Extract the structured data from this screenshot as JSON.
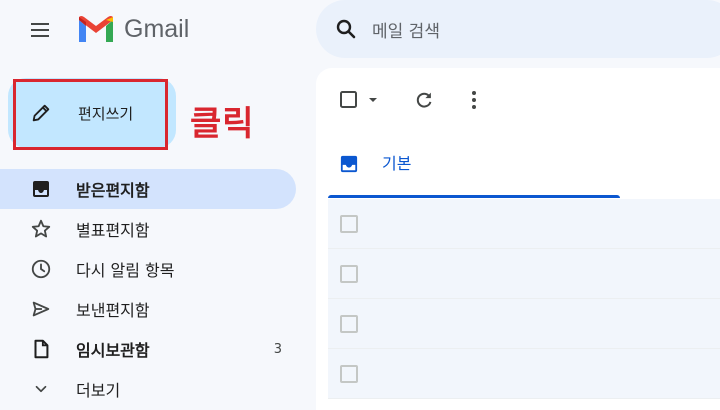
{
  "header": {
    "brand_text": "Gmail",
    "search_placeholder": "메일 검색"
  },
  "compose": {
    "label": "편지쓰기"
  },
  "annotation": {
    "text": "클릭",
    "color": "#d9262f"
  },
  "sidebar": {
    "items": [
      {
        "label": "받은편지함",
        "icon": "inbox-icon",
        "active": true,
        "bold": true
      },
      {
        "label": "별표편지함",
        "icon": "star-icon"
      },
      {
        "label": "다시 알림 항목",
        "icon": "clock-icon"
      },
      {
        "label": "보낸편지함",
        "icon": "send-icon"
      },
      {
        "label": "임시보관함",
        "icon": "draft-icon",
        "bold": true,
        "count": "3"
      },
      {
        "label": "더보기",
        "icon": "chevron-down-icon"
      }
    ]
  },
  "main": {
    "tabs": [
      {
        "label": "기본",
        "icon": "inbox-icon",
        "active": true
      }
    ]
  },
  "colors": {
    "compose_bg": "#c2e7ff",
    "active_nav_bg": "#d3e3fd",
    "accent_blue": "#0b57d0",
    "annotation_red": "#d9262f"
  }
}
